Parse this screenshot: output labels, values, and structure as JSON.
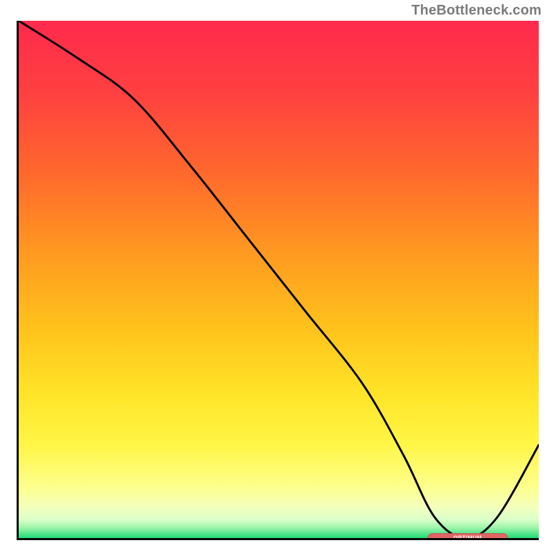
{
  "chart_data": {
    "type": "line",
    "attribution": "TheBottleneck.com",
    "xlim": [
      0,
      100
    ],
    "ylim": [
      0,
      100
    ],
    "x": [
      0,
      11,
      22,
      33,
      44,
      55,
      66,
      74,
      80,
      86,
      92,
      100
    ],
    "values": [
      100,
      93,
      85,
      72,
      58,
      44,
      30,
      16,
      4,
      0,
      4,
      18
    ],
    "optimum_x": 86,
    "marker": {
      "x": 86,
      "y": 0,
      "width_pct": 15,
      "label": "OPTIMUM"
    },
    "gradient_stops": [
      {
        "pct": 0,
        "color": "#ff2a4d"
      },
      {
        "pct": 14,
        "color": "#ff4040"
      },
      {
        "pct": 30,
        "color": "#ff6a2c"
      },
      {
        "pct": 45,
        "color": "#ff9a20"
      },
      {
        "pct": 60,
        "color": "#ffc41c"
      },
      {
        "pct": 72,
        "color": "#ffe428"
      },
      {
        "pct": 82,
        "color": "#fff646"
      },
      {
        "pct": 90,
        "color": "#fdff8c"
      },
      {
        "pct": 94,
        "color": "#f4ffbc"
      },
      {
        "pct": 96.5,
        "color": "#d9ffc8"
      },
      {
        "pct": 98,
        "color": "#9cf5a8"
      },
      {
        "pct": 100,
        "color": "#1fd97a"
      }
    ]
  }
}
